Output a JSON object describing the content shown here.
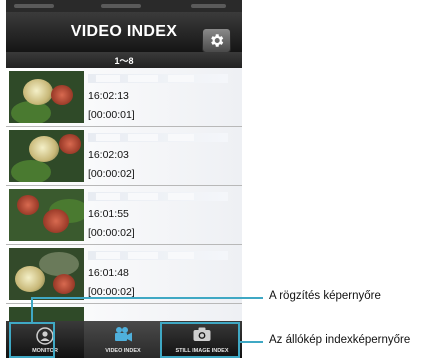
{
  "header": {
    "title": "VIDEO INDEX"
  },
  "range_label": "1～8",
  "videos": [
    {
      "time": "16:02:13",
      "duration": "[00:00:01]"
    },
    {
      "time": "16:02:03",
      "duration": "[00:00:02]"
    },
    {
      "time": "16:01:55",
      "duration": "[00:00:02]"
    },
    {
      "time": "16:01:48",
      "duration": "[00:00:02]"
    }
  ],
  "tabs": [
    {
      "label": "MONITOR",
      "icon": "monitor-icon"
    },
    {
      "label": "VIDEO INDEX",
      "icon": "video-camera-icon"
    },
    {
      "label": "STILL IMAGE INDEX",
      "icon": "camera-icon"
    }
  ],
  "annotations": [
    {
      "text": "A rögzítés képernyőre"
    },
    {
      "text": "Az állókép indexképernyőre"
    }
  ],
  "colors": {
    "highlight": "#3fa8c4",
    "header_bg": "#2a2a2a",
    "tabbar_bg": "#1a1a1a"
  }
}
